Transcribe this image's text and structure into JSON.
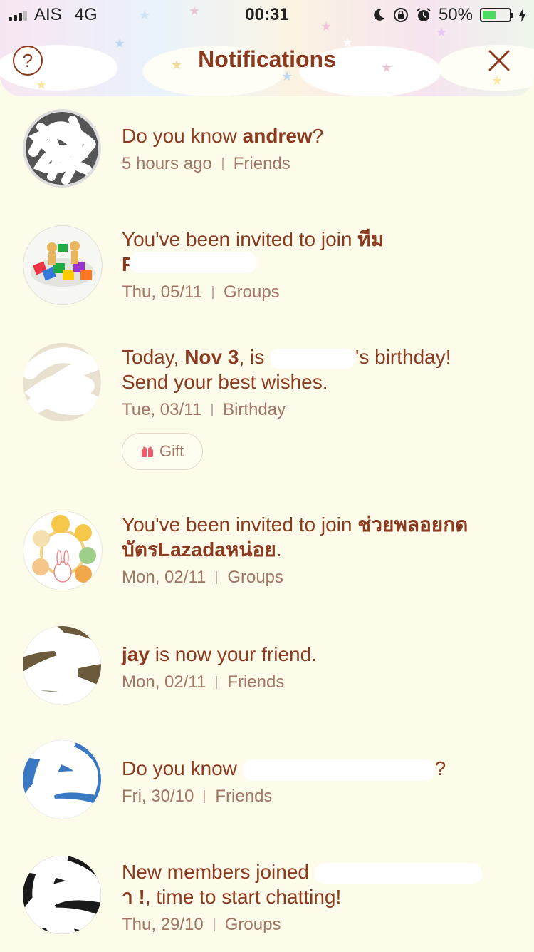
{
  "status_bar": {
    "carrier": "AIS",
    "network": "4G",
    "time": "00:31",
    "battery": "50%",
    "battery_level": 0.5
  },
  "header": {
    "title": "Notifications",
    "help_label": "?"
  },
  "notifications": [
    {
      "pre": "Do you know ",
      "bold": "andrew",
      "post": "?",
      "time": "5 hours ago",
      "category": "Friends"
    },
    {
      "line1": "You've been invited to join ",
      "bold": "ทีม",
      "line2_visible": "P",
      "time": "Thu, 05/11",
      "category": "Groups"
    },
    {
      "pre": "Today, ",
      "bold": "Nov 3",
      "mid": ", is ",
      "post": "'s birthday!",
      "line2": "Send your best wishes.",
      "time": "Tue, 03/11",
      "category": "Birthday",
      "gift_label": "Gift"
    },
    {
      "line1": "You've been invited to join ",
      "bold1": "ช่วยพลอยกด",
      "bold2": "บัตรLazadaหน่อย",
      "post": ".",
      "time": "Mon, 02/11",
      "category": "Groups"
    },
    {
      "bold": "jay",
      "post": " is now your friend.",
      "time": "Mon, 02/11",
      "category": "Friends"
    },
    {
      "pre": "Do you know ",
      "post": "?",
      "time": "Fri, 30/10",
      "category": "Friends"
    },
    {
      "pre": "New members joined ",
      "line2": ", time to start chatting!",
      "line2_bold": "า !",
      "time": "Thu, 29/10",
      "category": "Groups"
    }
  ]
}
